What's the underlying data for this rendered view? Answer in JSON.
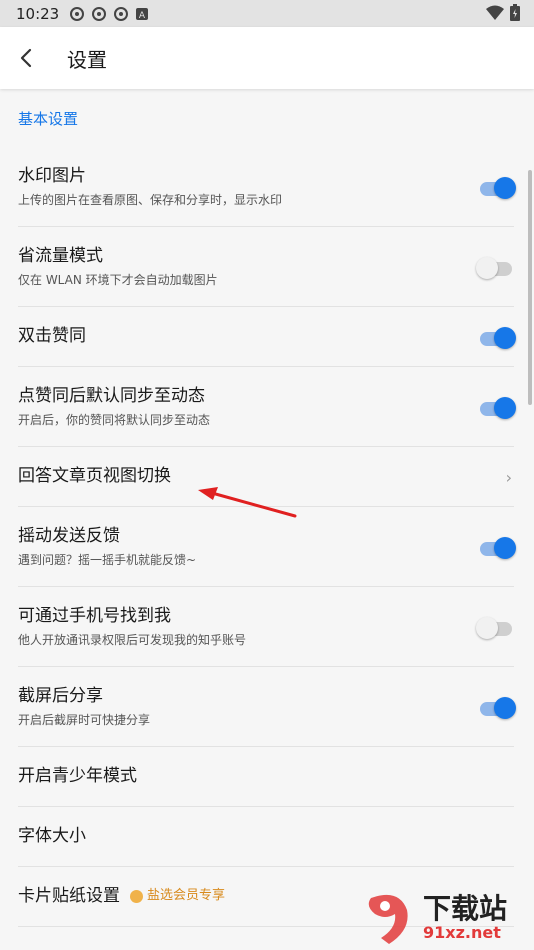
{
  "status_bar": {
    "time": "10:23"
  },
  "header": {
    "title": "设置"
  },
  "section": {
    "title": "基本设置"
  },
  "settings": [
    {
      "label": "水印图片",
      "sub": "上传的图片在查看原图、保存和分享时，显示水印",
      "control": "toggle",
      "on": true
    },
    {
      "label": "省流量模式",
      "sub": "仅在 WLAN 环境下才会自动加载图片",
      "control": "toggle",
      "on": false
    },
    {
      "label": "双击赞同",
      "sub": "",
      "control": "toggle",
      "on": true
    },
    {
      "label": "点赞同后默认同步至动态",
      "sub": "开启后，你的赞同将默认同步至动态",
      "control": "toggle",
      "on": true
    },
    {
      "label": "回答文章页视图切换",
      "sub": "",
      "control": "chevron"
    },
    {
      "label": "摇动发送反馈",
      "sub": "遇到问题？摇一摇手机就能反馈~",
      "control": "toggle",
      "on": true
    },
    {
      "label": "可通过手机号找到我",
      "sub": "他人开放通讯录权限后可发现我的知乎账号",
      "control": "toggle",
      "on": false
    },
    {
      "label": "截屏后分享",
      "sub": "开启后截屏时可快捷分享",
      "control": "toggle",
      "on": true
    },
    {
      "label": "开启青少年模式",
      "sub": "",
      "control": "none"
    },
    {
      "label": "字体大小",
      "sub": "",
      "control": "none"
    },
    {
      "label": "卡片贴纸设置",
      "badge": "盐选会员专享",
      "sub": "",
      "control": "none"
    }
  ],
  "watermark": {
    "text": "下载站",
    "domain": "91xz.net"
  },
  "colors": {
    "accent": "#1677e8",
    "annotation_arrow": "#e02020"
  }
}
